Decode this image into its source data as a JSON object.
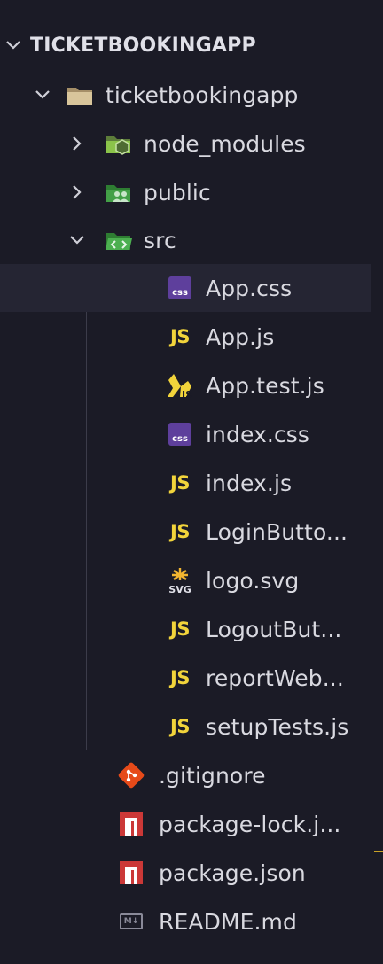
{
  "explorer": {
    "root": {
      "label": "TICKETBOOKINGAPP",
      "expanded": true
    },
    "items": [
      {
        "label": "ticketbookingapp",
        "kind": "folder",
        "icon": "folder-icon",
        "expanded": true
      },
      {
        "label": "node_modules",
        "kind": "folder",
        "icon": "node-folder-icon",
        "expanded": false
      },
      {
        "label": "public",
        "kind": "folder",
        "icon": "public-folder-icon",
        "expanded": false
      },
      {
        "label": "src",
        "kind": "folder",
        "icon": "src-folder-icon",
        "expanded": true
      },
      {
        "label": "App.css",
        "kind": "file",
        "icon": "css-file-icon",
        "badge": "css",
        "selected": true
      },
      {
        "label": "App.js",
        "kind": "file",
        "icon": "js-file-icon",
        "badge": "JS"
      },
      {
        "label": "App.test.js",
        "kind": "file",
        "icon": "test-js-file-icon"
      },
      {
        "label": "index.css",
        "kind": "file",
        "icon": "css-file-icon",
        "badge": "css"
      },
      {
        "label": "index.js",
        "kind": "file",
        "icon": "js-file-icon",
        "badge": "JS"
      },
      {
        "label": "LoginButto...",
        "kind": "file",
        "icon": "js-file-icon",
        "badge": "JS"
      },
      {
        "label": "logo.svg",
        "kind": "file",
        "icon": "svg-file-icon",
        "badge": "SVG"
      },
      {
        "label": "LogoutBut...",
        "kind": "file",
        "icon": "js-file-icon",
        "badge": "JS"
      },
      {
        "label": "reportWeb...",
        "kind": "file",
        "icon": "js-file-icon",
        "badge": "JS"
      },
      {
        "label": "setupTests.js",
        "kind": "file",
        "icon": "js-file-icon",
        "badge": "JS"
      },
      {
        "label": ".gitignore",
        "kind": "file",
        "icon": "git-file-icon"
      },
      {
        "label": "package-lock.j...",
        "kind": "file",
        "icon": "npm-file-icon"
      },
      {
        "label": "package.json",
        "kind": "file",
        "icon": "npm-file-icon"
      },
      {
        "label": "README.md",
        "kind": "file",
        "icon": "markdown-file-icon",
        "badge": "M↓"
      }
    ]
  },
  "colors": {
    "background": "#1b1b26",
    "selected_row": "#252533",
    "js_yellow": "#f2d43b",
    "css_purple": "#5e3f9c",
    "git_orange": "#e64a19",
    "npm_red": "#cb3837",
    "folder_tan": "#c9b38a",
    "node_green": "#8bc34a"
  }
}
